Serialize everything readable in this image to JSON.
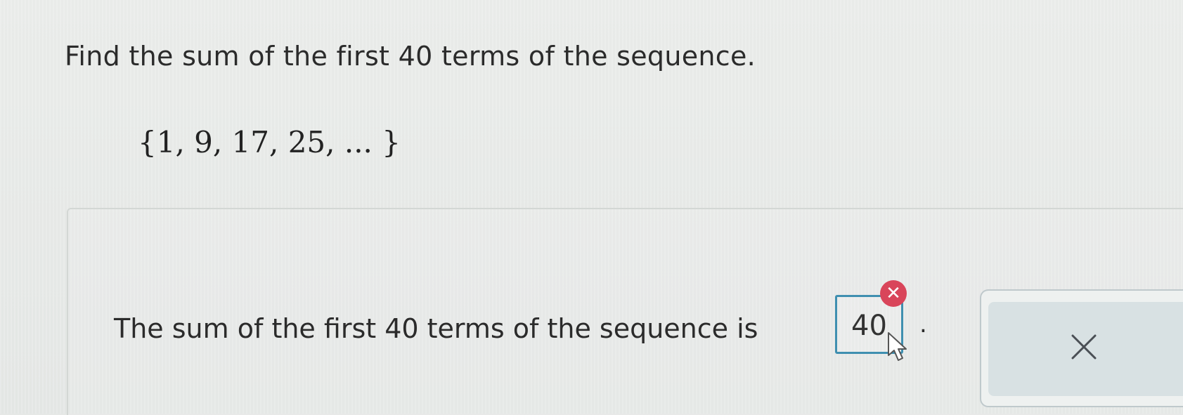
{
  "question": {
    "text": "Find the sum of the first 40 terms of the sequence.",
    "sequence": "{1, 9, 17, 25, ... }"
  },
  "answer": {
    "sentence": "The sum of the first 40 terms of the sequence is",
    "value": "40",
    "suffix": ".",
    "status": "incorrect",
    "status_icon": "x-icon",
    "accent_color": "#3f8fb0",
    "error_color": "#d9455a"
  },
  "actions": {
    "clear_icon": "close-icon"
  }
}
